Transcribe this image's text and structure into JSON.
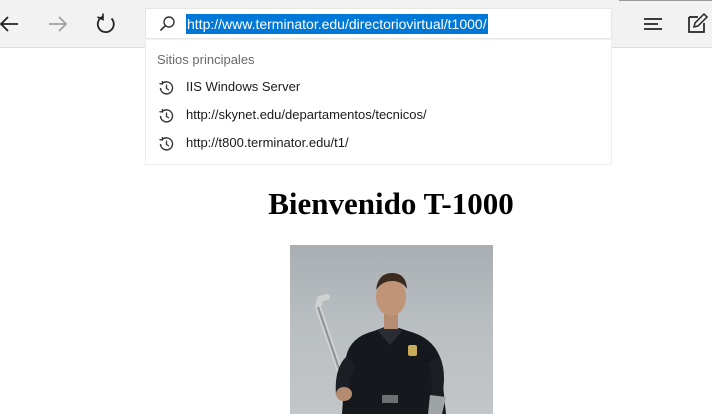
{
  "browser": {
    "address_value": "http://www.terminator.edu/directoriovirtual/t1000/",
    "icons": [
      "back-icon",
      "forward-icon",
      "refresh-icon",
      "search-icon",
      "hub-icon",
      "web-note-icon",
      "history-icon"
    ]
  },
  "dropdown": {
    "heading": "Sitios principales",
    "suggestions": [
      "IIS Windows Server",
      "http://skynet.edu/departamentos/tecnicos/",
      "http://t800.terminator.edu/t1/"
    ]
  },
  "page": {
    "heading": "Bienvenido T-1000"
  }
}
